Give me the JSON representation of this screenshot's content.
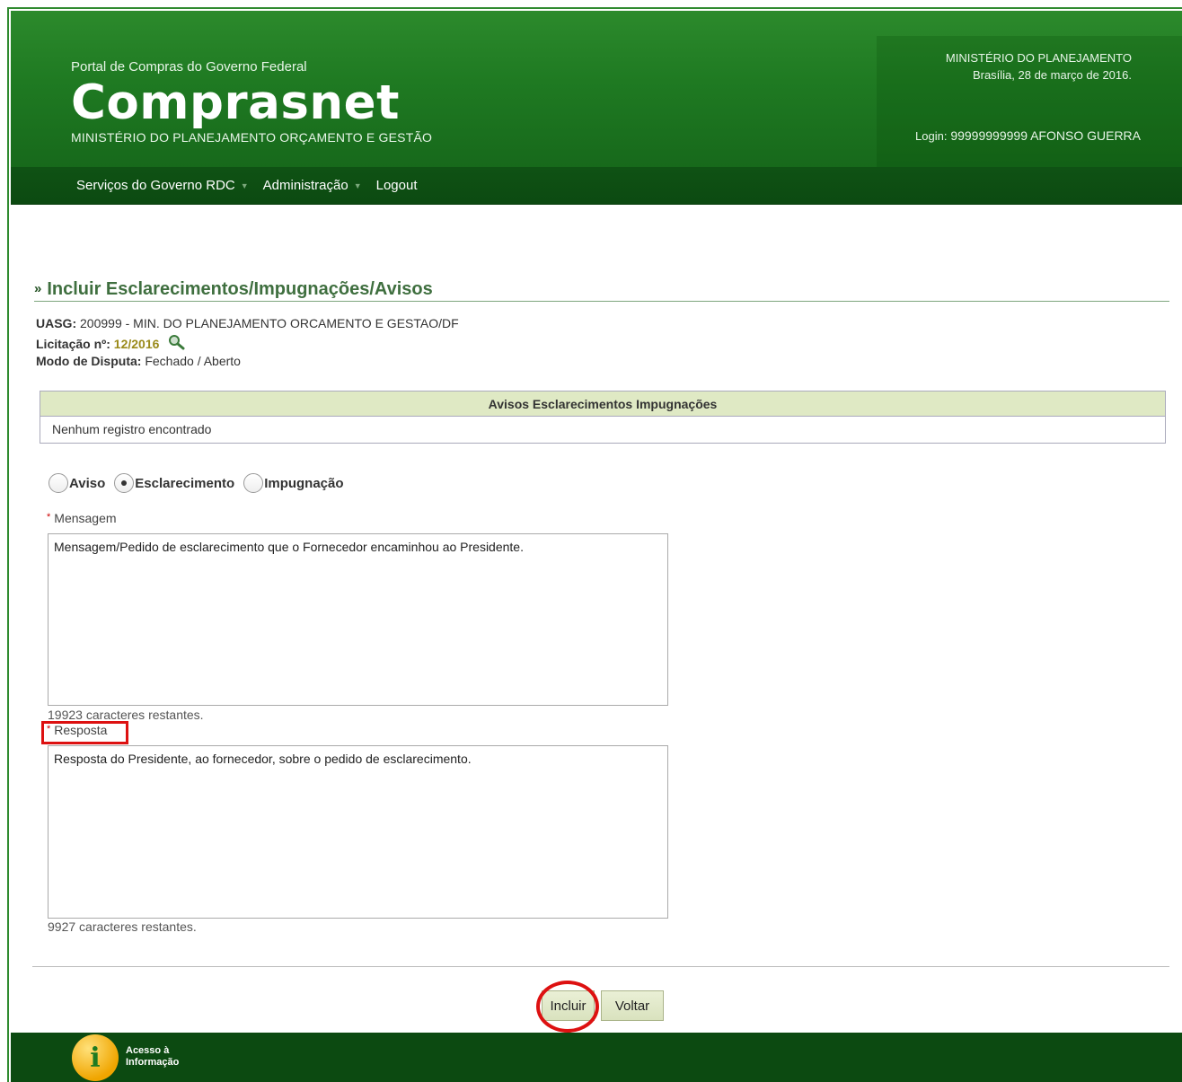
{
  "header": {
    "portal_subtitle": "Portal de Compras do Governo Federal",
    "logo": "Comprasnet",
    "ministry": "MINISTÉRIO DO PLANEJAMENTO ORÇAMENTO E GESTÃO",
    "right_ministry": "MINISTÉRIO DO PLANEJAMENTO",
    "date": "Brasília, 28 de março de 2016.",
    "login_label": "Login:",
    "login_value": "99999999999 AFONSO GUERRA"
  },
  "nav": {
    "items": [
      {
        "label": "Serviços do Governo RDC",
        "has_dropdown": true
      },
      {
        "label": "Administração",
        "has_dropdown": true
      },
      {
        "label": "Logout",
        "has_dropdown": false
      }
    ]
  },
  "page": {
    "title": "Incluir Esclarecimentos/Impugnações/Avisos",
    "uasg_label": "UASG:",
    "uasg_value": "200999 - MIN. DO PLANEJAMENTO ORCAMENTO E GESTAO/DF",
    "licitacao_label": "Licitação nº:",
    "licitacao_value": "12/2016",
    "modo_label": "Modo de Disputa:",
    "modo_value": "Fechado / Aberto"
  },
  "table": {
    "header": "Avisos Esclarecimentos Impugnações",
    "empty_message": "Nenhum registro encontrado"
  },
  "form": {
    "radio_options": [
      "Aviso",
      "Esclarecimento",
      "Impugnação"
    ],
    "selected_option": "Esclarecimento",
    "mensagem_label": "Mensagem",
    "mensagem_value": "Mensagem/Pedido de esclarecimento  que o Fornecedor encaminhou ao Presidente.",
    "mensagem_counter": "19923 caracteres restantes.",
    "resposta_label": "Resposta",
    "resposta_value": "Resposta do Presidente, ao fornecedor, sobre o pedido de esclarecimento.",
    "resposta_counter": "9927 caracteres restantes."
  },
  "buttons": {
    "incluir": "Incluir",
    "voltar": "Voltar"
  },
  "footer": {
    "acesso_line1": "Acesso à",
    "acesso_line2": "Informação"
  },
  "colors": {
    "header_green": "#1f7a22",
    "nav_green": "#0c4a11",
    "title_green": "#3f6f3f",
    "table_header_bg": "#dfe9c4",
    "annotation_red": "#dd1111"
  }
}
